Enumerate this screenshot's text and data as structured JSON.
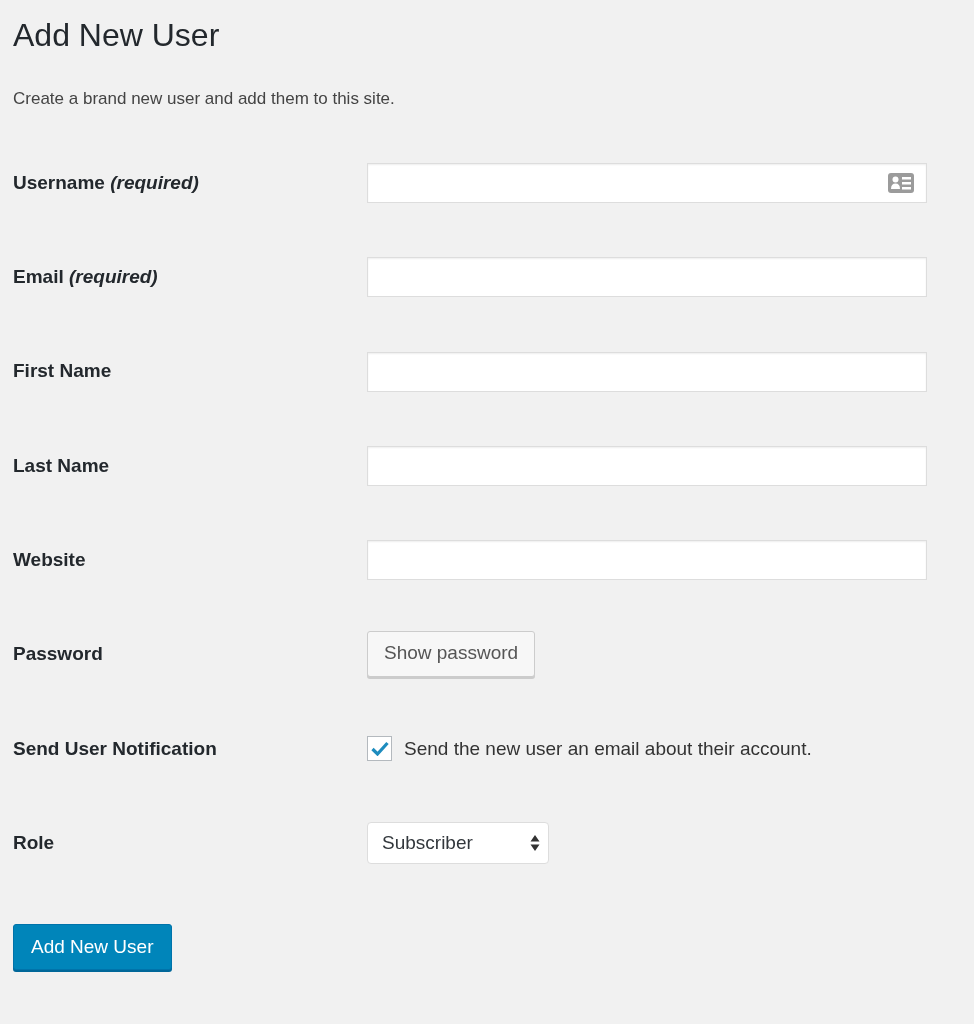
{
  "title": "Add New User",
  "description": "Create a brand new user and add them to this site.",
  "fields": [
    {
      "kind": "text",
      "label": "Username *(required)*",
      "autofill_icon": true
    },
    {
      "kind": "text",
      "label": "Email *(required)*"
    },
    {
      "kind": "text",
      "label": "First Name"
    },
    {
      "kind": "text",
      "label": "Last Name"
    },
    {
      "kind": "text",
      "label": "Website"
    },
    {
      "kind": "button",
      "label": "Password",
      "button": "Show password"
    },
    {
      "kind": "checkbox",
      "label": "Send User Notification",
      "checked": true,
      "text": "Send the new user an email about their account."
    },
    {
      "kind": "select",
      "label": "Role",
      "value": "Subscriber"
    }
  ],
  "submit": "Add New User"
}
